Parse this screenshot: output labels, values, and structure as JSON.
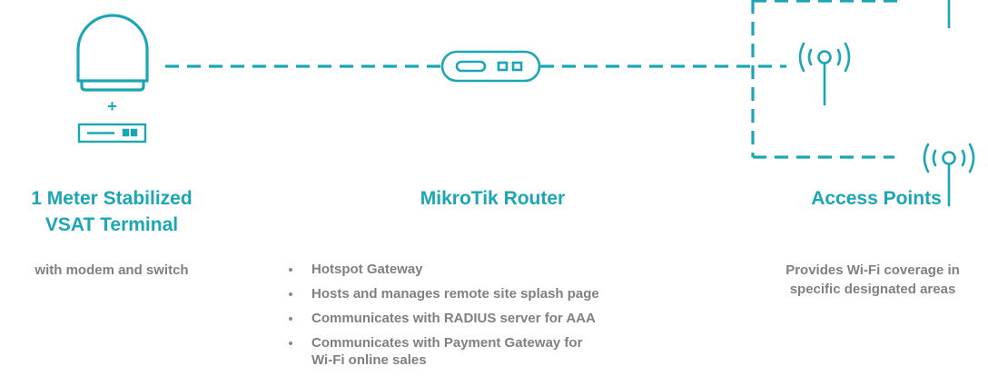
{
  "colors": {
    "accent": "#1aa6b4",
    "text": "#808080"
  },
  "icons": {
    "terminal": "satellite-dome-icon",
    "plus": "plus-icon",
    "modem": "modem-switch-icon",
    "router": "router-icon",
    "access_point": "wifi-access-point-icon"
  },
  "vsat": {
    "plus_sign": "+",
    "title_lines": [
      "1 Meter Stabilized",
      "VSAT Terminal"
    ],
    "description": "with modem and switch"
  },
  "router": {
    "title": "MikroTik Router",
    "bullets": [
      [
        "Hotspot Gateway"
      ],
      [
        "Hosts and manages remote site splash page"
      ],
      [
        "Communicates with RADIUS server for AAA"
      ],
      [
        "Communicates with Payment Gateway for",
        "Wi-Fi online sales"
      ]
    ]
  },
  "access_points": {
    "title": "Access Points",
    "description_lines": [
      "Provides Wi-Fi coverage in",
      "specific designated areas"
    ]
  }
}
